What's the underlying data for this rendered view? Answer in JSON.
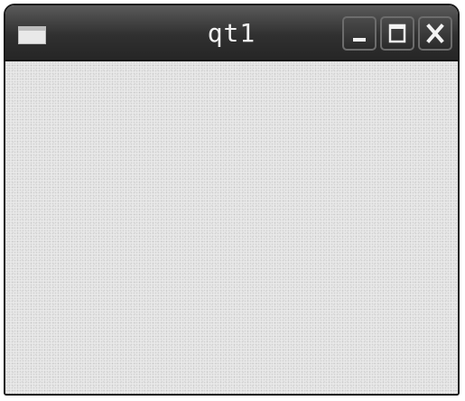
{
  "window": {
    "title": "qt1",
    "icons": {
      "app": "window-icon",
      "minimize": "minimize-icon",
      "maximize": "maximize-icon",
      "close": "close-icon"
    },
    "colors": {
      "titlebar": "#303030",
      "title_text": "#f2f2f2",
      "client_background": "#e8e8e8",
      "border": "#1a1a1a"
    }
  }
}
